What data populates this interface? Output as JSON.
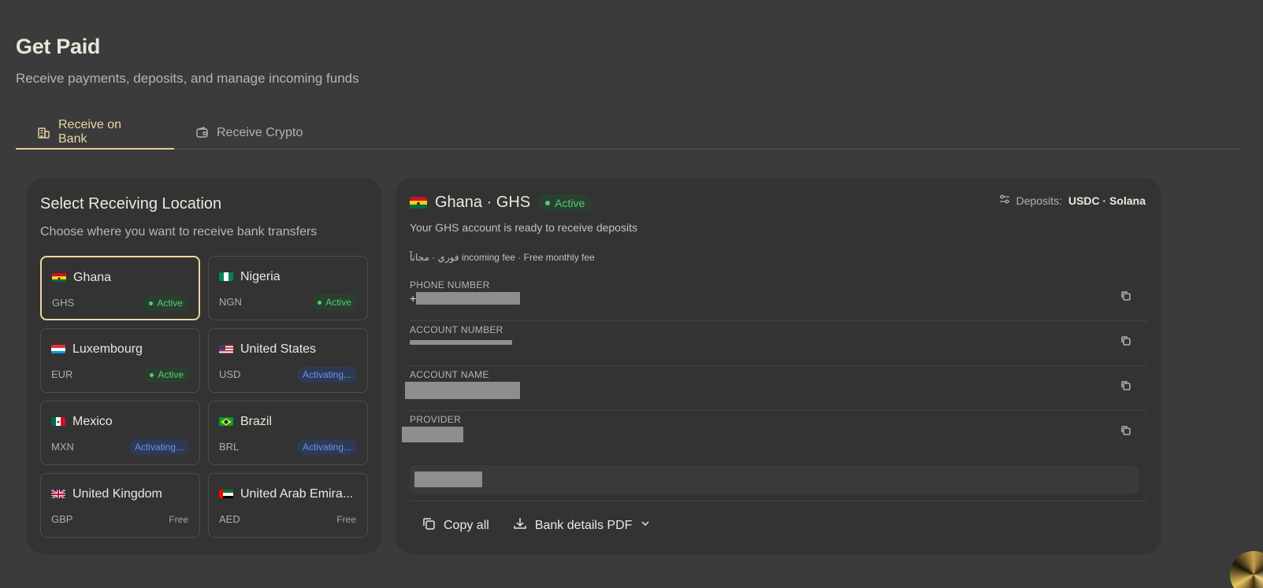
{
  "header": {
    "title": "Get Paid",
    "subtitle": "Receive payments, deposits, and manage incoming funds"
  },
  "tabs": [
    {
      "label": "Receive on Bank",
      "icon": "bank-icon",
      "active": true
    },
    {
      "label": "Receive Crypto",
      "icon": "wallet-icon",
      "active": false
    }
  ],
  "locations": {
    "title": "Select Receiving Location",
    "subtitle": "Choose where you want to receive bank transfers",
    "items": [
      {
        "country": "Ghana",
        "code": "GHS",
        "status": "Active",
        "selected": true
      },
      {
        "country": "Nigeria",
        "code": "NGN",
        "status": "Active"
      },
      {
        "country": "Luxembourg",
        "code": "EUR",
        "status": "Active"
      },
      {
        "country": "United States",
        "code": "USD",
        "status": "Activating..."
      },
      {
        "country": "Mexico",
        "code": "MXN",
        "status": "Activating..."
      },
      {
        "country": "Brazil",
        "code": "BRL",
        "status": "Activating..."
      },
      {
        "country": "United Kingdom",
        "code": "GBP",
        "status": "Free"
      },
      {
        "country": "United Arab Emira...",
        "code": "AED",
        "status": "Free"
      }
    ]
  },
  "details": {
    "title": "Ghana · GHS",
    "status": "Active",
    "deposits_label": "Deposits:",
    "deposits_value": "USDC · Solana",
    "description": "Your GHS account is ready to receive deposits",
    "fee_text": "فوري · مجاناً incoming fee · Free monthly fee",
    "fields": [
      {
        "label": "PHONE NUMBER",
        "prefix": "+"
      },
      {
        "label": "ACCOUNT NUMBER",
        "prefix": ""
      },
      {
        "label": "ACCOUNT NAME",
        "prefix": ""
      },
      {
        "label": "PROVIDER",
        "prefix": ""
      }
    ],
    "actions": {
      "copy_all": "Copy all",
      "pdf": "Bank details PDF"
    }
  },
  "colors": {
    "background": "#3b3b3b",
    "panel": "#333333",
    "accent": "#ead7a0",
    "active_green": "#4fcf74",
    "activating_blue": "#6a93ea"
  }
}
